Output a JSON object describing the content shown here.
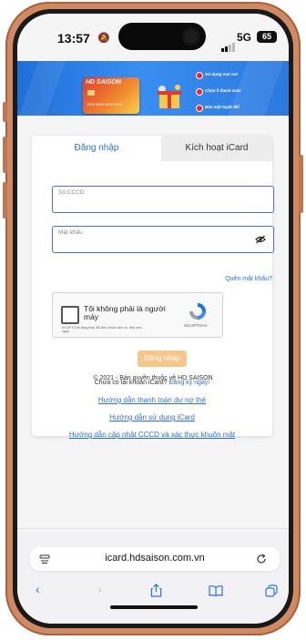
{
  "status_bar": {
    "time": "13:57",
    "network": "5G",
    "battery": "65"
  },
  "banner": {
    "card_brand": "HD SAISON",
    "card_number": "4200 0000 0000 0000",
    "items": [
      "Sử dụng mọi nơi",
      "Chọn lì thanh toán",
      "Bảo mật tuyệt đối"
    ]
  },
  "tabs": {
    "login": "Đăng nhập",
    "activate": "Kích hoạt iCard"
  },
  "form": {
    "cccd_placeholder": "Số CCCD",
    "password_placeholder": "Mật khẩu",
    "forgot_password": "Quên mật khẩu?",
    "login_button": "Đăng nhập"
  },
  "captcha": {
    "label": "Tôi không phải là người máy",
    "fine_print": "reCAPTCHA đang thay đổi điều khoản dịch vụ. Hãy xem ngay.",
    "brand": "reCAPTCHA"
  },
  "links": {
    "no_account": "Chưa có tài khoản iCard?",
    "register": "Đăng ký ngay!",
    "payment_guide": "Hướng dẫn thanh toán dư nợ thẻ",
    "usage_guide": "Hướng dẫn sử dụng iCard",
    "update_guide": "Hướng dẫn cập nhật CCCD và xác thực khuôn mặt"
  },
  "footer": {
    "copyright": "© 2021 - Bản quyền thuộc về HD SAISON"
  },
  "browser": {
    "url": "icard.hdsaison.com.vn"
  },
  "colors": {
    "accent": "#2f6fd4",
    "button": "#f7c68a",
    "frame": "#d08a63"
  }
}
